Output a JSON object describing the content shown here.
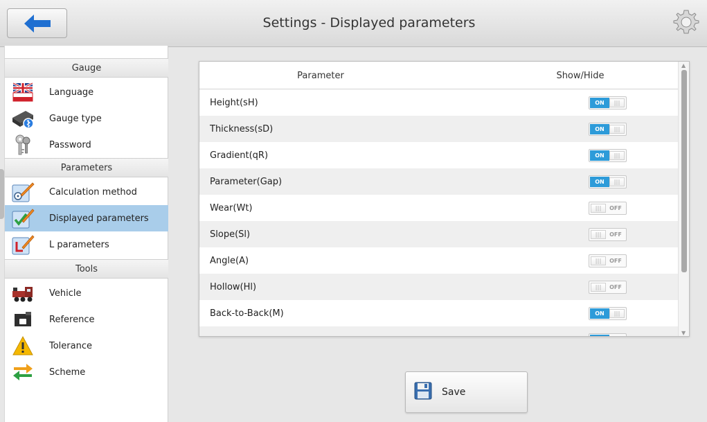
{
  "header": {
    "title": "Settings - Displayed parameters"
  },
  "sidebar": {
    "sections": [
      "Gauge",
      "Parameters",
      "Tools"
    ],
    "items": [
      {
        "label": "Language",
        "icon": "uk-flag-icon"
      },
      {
        "label": "Gauge type",
        "icon": "gauge-device-icon"
      },
      {
        "label": "Password",
        "icon": "keys-icon"
      },
      {
        "label": "Calculation method",
        "icon": "calculation-clipboard-icon"
      },
      {
        "label": "Displayed parameters",
        "icon": "checklist-clipboard-icon"
      },
      {
        "label": "L parameters",
        "icon": "l-clipboard-icon"
      },
      {
        "label": "Vehicle",
        "icon": "locomotive-icon"
      },
      {
        "label": "Reference",
        "icon": "reference-block-icon"
      },
      {
        "label": "Tolerance",
        "icon": "warning-icon"
      },
      {
        "label": "Scheme",
        "icon": "swap-arrows-icon"
      }
    ]
  },
  "table": {
    "col_parameter": "Parameter",
    "col_show": "Show/Hide",
    "on_text": "ON",
    "off_text": "OFF",
    "rows": [
      {
        "label": "Height(sH)",
        "state": "on"
      },
      {
        "label": "Thickness(sD)",
        "state": "on"
      },
      {
        "label": "Gradient(qR)",
        "state": "on"
      },
      {
        "label": "Parameter(Gap)",
        "state": "on"
      },
      {
        "label": "Wear(Wt)",
        "state": "off"
      },
      {
        "label": "Slope(Sl)",
        "state": "off"
      },
      {
        "label": "Angle(A)",
        "state": "off"
      },
      {
        "label": "Hollow(Hl)",
        "state": "off"
      },
      {
        "label": "Back-to-Back(M)",
        "state": "on"
      }
    ]
  },
  "save": {
    "label": "Save"
  },
  "colors": {
    "accent": "#2d9bd9",
    "active_item": "#a9cdea",
    "back_arrow": "#1f6fd1"
  }
}
